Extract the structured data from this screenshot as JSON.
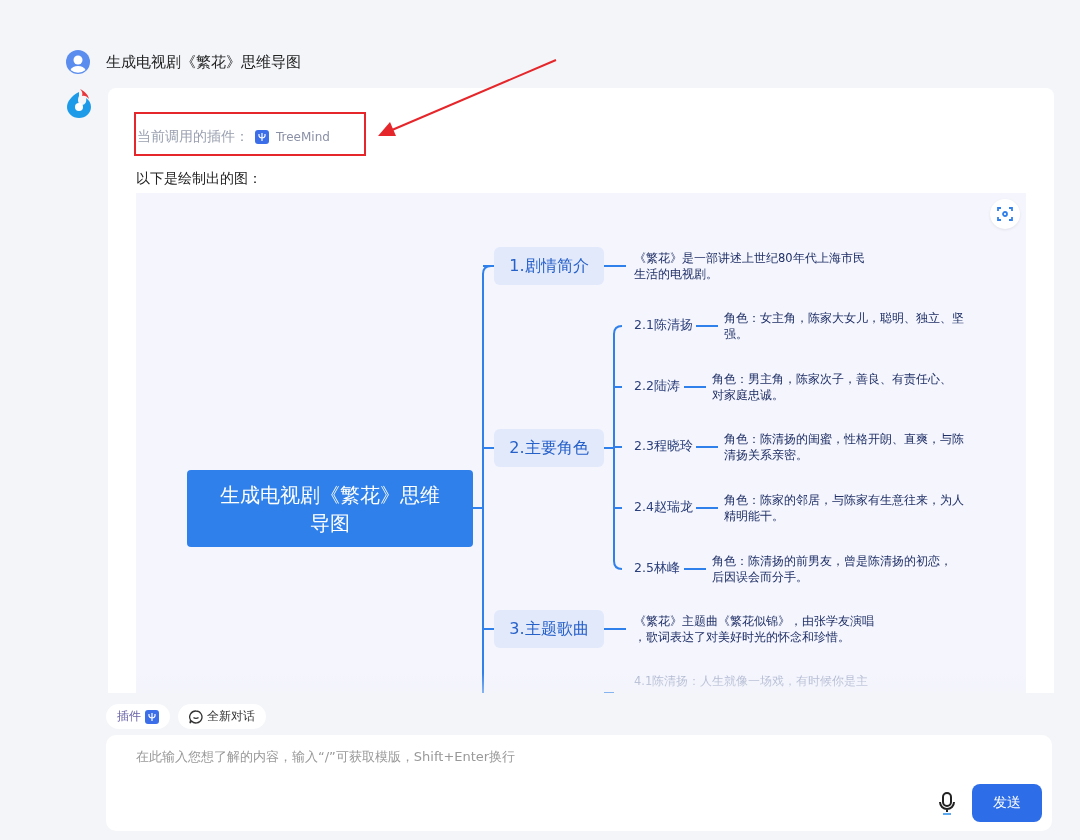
{
  "user_message": {
    "text": "生成电视剧《繁花》思维导图"
  },
  "reply": {
    "plugin_label": "当前调用的插件：",
    "plugin_name": "TreeMind",
    "intro": "以下是绘制出的图：",
    "mindmap": {
      "root": "生成电视剧《繁花》思维导图",
      "branches": [
        {
          "label": "1.剧情简介",
          "leaf": [
            "《繁花》是一部讲述上世纪80年代上海市民",
            "生活的电视剧。"
          ]
        },
        {
          "label": "2.主要角色",
          "children": [
            {
              "label": "2.1陈清扬",
              "leaf": [
                "角色：女主角，陈家大女儿，聪明、独立、坚",
                "强。"
              ]
            },
            {
              "label": "2.2陆涛",
              "leaf": [
                "角色：男主角，陈家次子，善良、有责任心、",
                "对家庭忠诚。"
              ]
            },
            {
              "label": "2.3程晓玲",
              "leaf": [
                "角色：陈清扬的闺蜜，性格开朗、直爽，与陈",
                "清扬关系亲密。"
              ]
            },
            {
              "label": "2.4赵瑞龙",
              "leaf": [
                "角色：陈家的邻居，与陈家有生意往来，为人",
                "精明能干。"
              ]
            },
            {
              "label": "2.5林峰",
              "leaf": [
                "角色：陈清扬的前男友，曾是陈清扬的初恋，",
                "后因误会而分手。"
              ]
            }
          ]
        },
        {
          "label": "3.主题歌曲",
          "leaf": [
            "《繁花》主题曲《繁花似锦》，由张学友演唱",
            "，歌词表达了对美好时光的怀念和珍惜。"
          ]
        }
      ],
      "faded_fragment": "4.1陈清扬：人生就像一场戏，有时候你是主"
    }
  },
  "chips": [
    {
      "label": "插件",
      "kind": "plugin"
    },
    {
      "label": "全新对话",
      "kind": "new-chat"
    }
  ],
  "composer": {
    "placeholder": "在此输入您想了解的内容，输入“/”可获取模版，Shift+Enter换行",
    "send": "发送"
  }
}
